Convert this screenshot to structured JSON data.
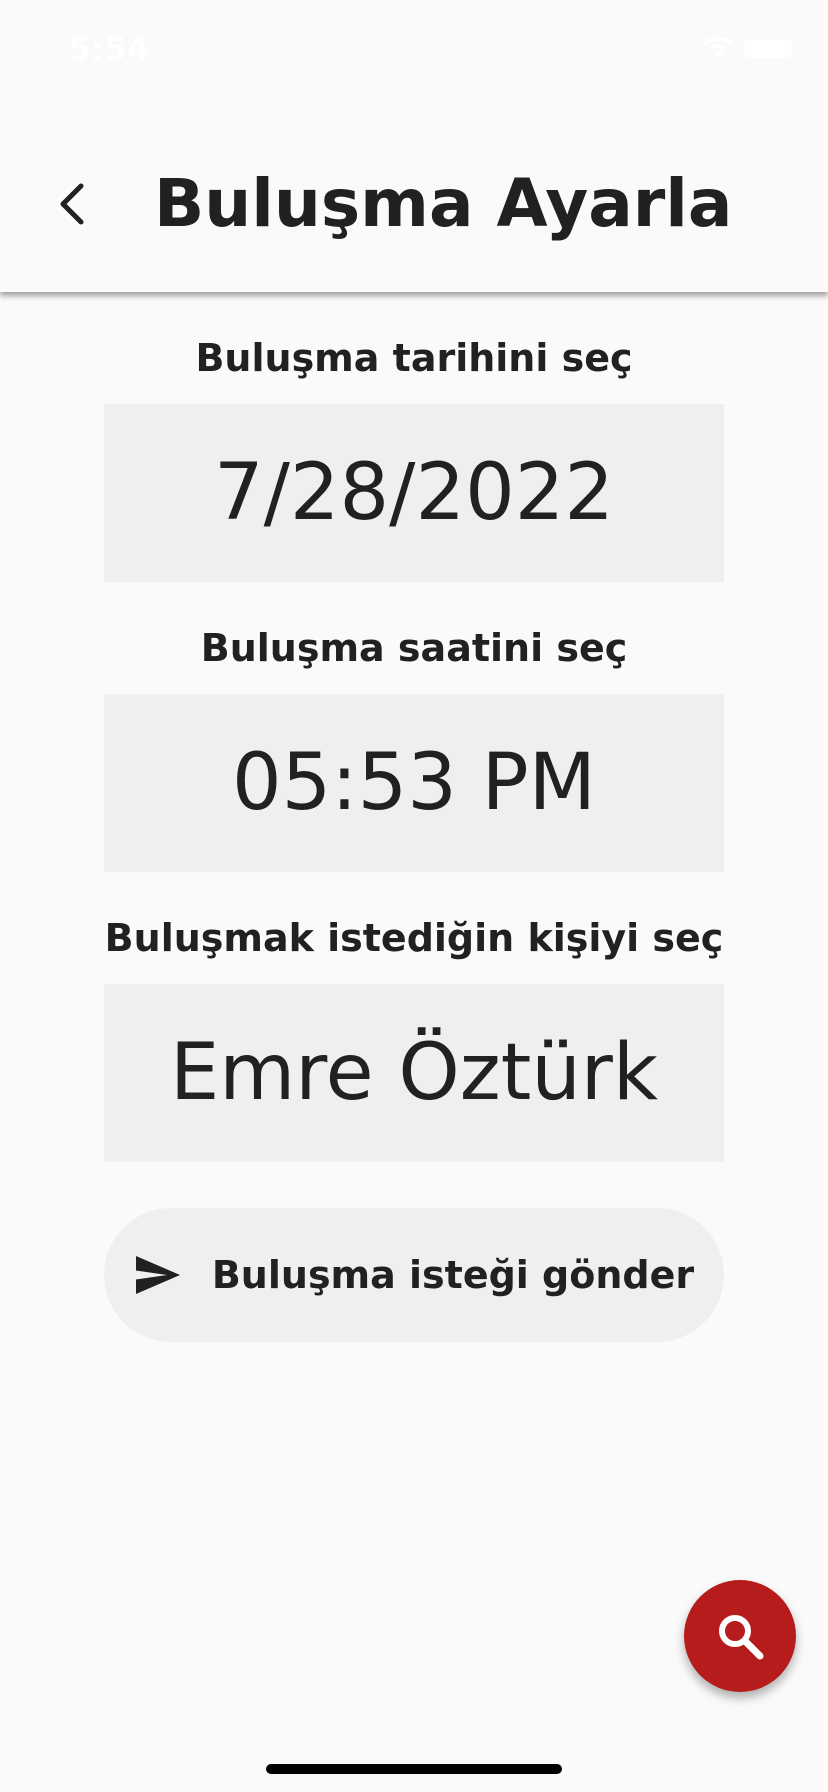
{
  "status_bar": {
    "time": "5:54",
    "icons": [
      "wifi-icon",
      "battery-icon"
    ]
  },
  "header": {
    "back_icon": "chevron-left-icon",
    "title": "Buluşma Ayarla"
  },
  "form": {
    "date_label": "Buluşma tarihini seç",
    "date_value": "7/28/2022",
    "time_label": "Buluşma saatini seç",
    "time_value": "05:53 PM",
    "person_label": "Buluşmak istediğin kişiyi seç",
    "person_value": "Emre Öztürk"
  },
  "send_button": {
    "icon": "send-icon",
    "label": "Buluşma isteği gönder"
  },
  "fab": {
    "icon": "search-icon",
    "color": "#b71c1c"
  },
  "colors": {
    "background": "#fafafa",
    "field_background": "#efefef",
    "text": "#212121",
    "accent": "#b71c1c"
  }
}
